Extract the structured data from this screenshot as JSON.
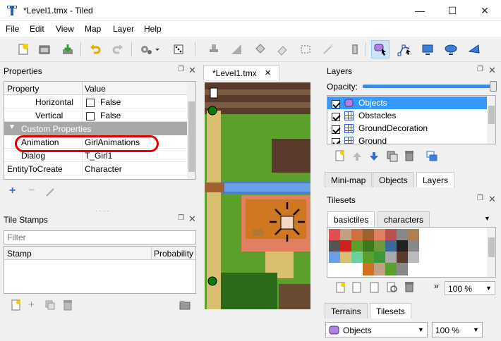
{
  "window": {
    "title": "*Level1.tmx - Tiled",
    "minimize": "—",
    "maximize": "☐",
    "close": "✕"
  },
  "menu": [
    "File",
    "Edit",
    "View",
    "Map",
    "Layer",
    "Help"
  ],
  "toolbar": {
    "icons": [
      "new-map-icon",
      "open-icon",
      "save-icon",
      "undo-icon",
      "redo-icon",
      "commands-icon",
      "random-icon",
      "stamp-brush-icon",
      "bucket-fill-icon",
      "shape-fill-icon",
      "eraser-icon",
      "rect-select-icon",
      "magic-wand-icon",
      "select-same-tile-icon",
      "select-objects-icon",
      "edit-polygons-icon",
      "insert-rectangle-icon",
      "insert-ellipse-icon",
      "insert-polygon-icon"
    ],
    "active": "select-objects-icon"
  },
  "properties": {
    "title": "Properties",
    "header": {
      "property": "Property",
      "value": "Value"
    },
    "rows": [
      {
        "name": "Horizontal",
        "value": "False",
        "checkbox": true
      },
      {
        "name": "Vertical",
        "value": "False",
        "checkbox": true
      },
      {
        "name": "Custom Properties",
        "group": true
      },
      {
        "name": "Animation",
        "value": "GirlAnimations",
        "highlight": true
      },
      {
        "name": "Dialog",
        "value": "T_Girl1"
      },
      {
        "name": "EntityToCreate",
        "value": "Character"
      }
    ],
    "highlight_color": "#e00000"
  },
  "tile_stamps": {
    "title": "Tile Stamps",
    "filter_placeholder": "Filter",
    "columns": {
      "stamp": "Stamp",
      "probability": "Probability"
    }
  },
  "document": {
    "tab": "*Level1.tmx",
    "close": "✕"
  },
  "layers": {
    "title": "Layers",
    "opacity_label": "Opacity:",
    "opacity": 1.0,
    "items": [
      {
        "name": "Objects",
        "type": "object",
        "checked": true,
        "selected": true
      },
      {
        "name": "Obstacles",
        "type": "tile",
        "checked": true
      },
      {
        "name": "GroundDecoration",
        "type": "tile",
        "checked": true
      },
      {
        "name": "Ground",
        "type": "tile",
        "checked": true
      }
    ],
    "tabs": [
      "Mini-map",
      "Objects",
      "Layers"
    ],
    "active_tab": "Layers"
  },
  "tilesets": {
    "title": "Tilesets",
    "tabs": [
      "basictiles",
      "characters"
    ],
    "active_tab": "basictiles",
    "zoom": "100 %",
    "bottom_tabs": [
      "Terrains",
      "Tilesets"
    ],
    "active_bottom_tab": "Tilesets",
    "layer_combo": "Objects",
    "layer_zoom": "100 %"
  }
}
